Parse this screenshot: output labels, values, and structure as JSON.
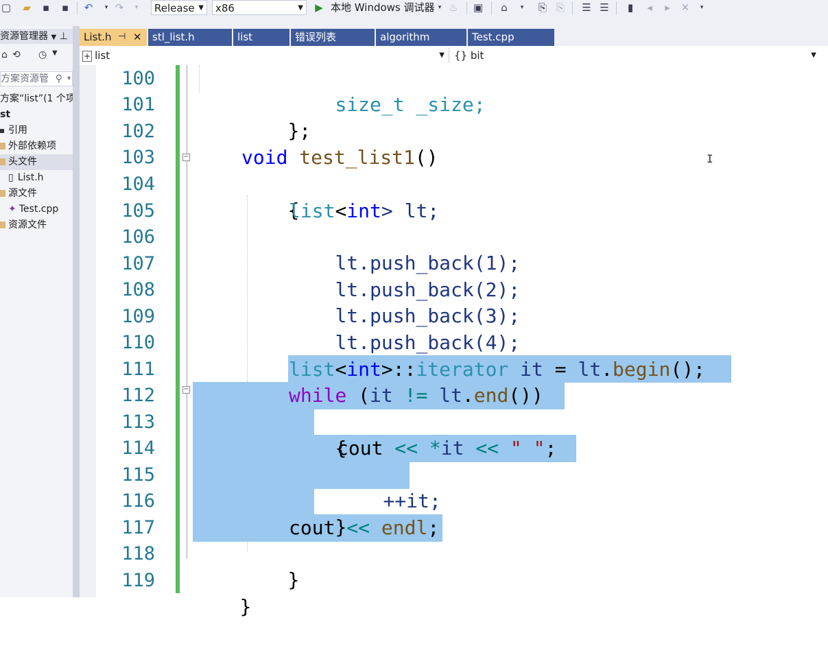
{
  "toolbar": {
    "configuration": "Release",
    "platform": "x86",
    "run_label": "本地 Windows 调试器"
  },
  "solution_explorer": {
    "title": "资源管理器",
    "search_placeholder": "方案资源管",
    "items": [
      {
        "label": "方案“list”(1 个项"
      },
      {
        "label": "st"
      },
      {
        "label": "引用"
      },
      {
        "label": "外部依赖项"
      },
      {
        "label": "头文件"
      },
      {
        "label": "List.h"
      },
      {
        "label": "源文件"
      },
      {
        "label": "Test.cpp"
      },
      {
        "label": "资源文件"
      }
    ]
  },
  "tabs": [
    {
      "label": "List.h",
      "active": true
    },
    {
      "label": "stl_list.h"
    },
    {
      "label": "list"
    },
    {
      "label": "错误列表"
    },
    {
      "label": "algorithm"
    },
    {
      "label": "Test.cpp"
    }
  ],
  "navbar": {
    "scope": "list",
    "member": "{} bit"
  },
  "editor": {
    "lines": [
      {
        "num": "100"
      },
      {
        "num": "101"
      },
      {
        "num": "102"
      },
      {
        "num": "103"
      },
      {
        "num": "104"
      },
      {
        "num": "105"
      },
      {
        "num": "106"
      },
      {
        "num": "107"
      },
      {
        "num": "108"
      },
      {
        "num": "109"
      },
      {
        "num": "110"
      },
      {
        "num": "111"
      },
      {
        "num": "112"
      },
      {
        "num": "113"
      },
      {
        "num": "114"
      },
      {
        "num": "115"
      },
      {
        "num": "116"
      },
      {
        "num": "117"
      },
      {
        "num": "118"
      },
      {
        "num": "119"
      }
    ],
    "code": {
      "l100": "size_t _size;",
      "l101": "};",
      "l103_kw": "void",
      "l103_fn": "test_list1",
      "l103_rest": "()",
      "l104": "{",
      "l105_type": "list",
      "l105_kw": "int",
      "l105_rest": "> lt;",
      "l106": "lt.push_back(1);",
      "l107": "lt.push_back(2);",
      "l108": "lt.push_back(3);",
      "l109": "lt.push_back(4);",
      "l111_type": "list",
      "l111_kw": "int",
      "l111_iter": "iterator",
      "l111_var": "it",
      "l111_begin": "begin",
      "l112_kw": "while",
      "l112_var": "it",
      "l112_lt": "lt",
      "l112_end": "end",
      "l113": "{",
      "l114_cout": "cout",
      "l114_str": "\" \"",
      "l115": "++it;",
      "l116": "}",
      "l117_cout": "cout",
      "l117_endl": "endl",
      "l118": "}",
      "l119": "}"
    }
  },
  "colors": {
    "keyword": "#0000ff",
    "type": "#2b91af",
    "function": "#74531f",
    "control": "#8f08c4",
    "string": "#a31515",
    "selection": "#9ac8ee",
    "tab_active": "#f5cc84",
    "tab_inactive": "#3e5a9a"
  }
}
